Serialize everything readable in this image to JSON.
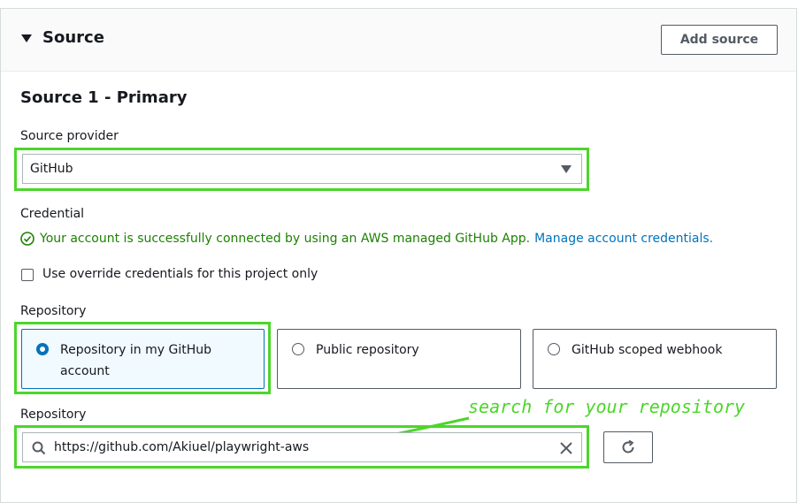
{
  "section": {
    "title": "Source",
    "add_button": "Add source"
  },
  "source": {
    "heading": "Source 1 - Primary",
    "provider_label": "Source provider",
    "provider_value": "GitHub",
    "credential_label": "Credential",
    "credential_status": "Your account is successfully connected by using an AWS managed GitHub App.",
    "credential_link": "Manage account credentials.",
    "override_label": "Use override credentials for this project only",
    "override_checked": false,
    "repository_label": "Repository",
    "repository_options": [
      {
        "line1": "Repository in my GitHub",
        "line2": "account",
        "selected": true
      },
      {
        "line1": "Public repository",
        "line2": "",
        "selected": false
      },
      {
        "line1": "GitHub scoped webhook",
        "line2": "",
        "selected": false
      }
    ],
    "repository_search_label": "Repository",
    "repository_search_value": "https://github.com/Akiuel/playwright-aws"
  },
  "annotation": {
    "text": "search for your repository"
  },
  "colors": {
    "highlight": "#4cd62b",
    "success": "#1d8102",
    "link": "#0073bb"
  }
}
